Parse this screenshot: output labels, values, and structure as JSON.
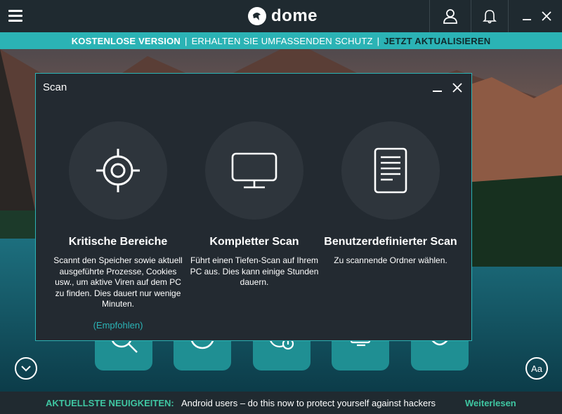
{
  "app": {
    "logo_text": "dome",
    "icons": {
      "menu": "hamburger-icon",
      "user": "user-icon",
      "notifications": "bell-icon",
      "minimize": "minimize-icon",
      "close": "close-icon"
    }
  },
  "promo": {
    "free_version": "KOSTENLOSE VERSION",
    "full_protection": "ERHALTEN SIE UMFASSENDEN SCHUTZ",
    "upgrade": "JETZT AKTUALISIEREN",
    "separator": "|"
  },
  "dialog": {
    "title": "Scan",
    "options": [
      {
        "title": "Kritische Bereiche",
        "description": "Scannt den Speicher sowie aktuell ausgeführte Prozesse, Cookies usw., um aktive Viren auf dem PC zu finden. Dies dauert nur wenige Minuten.",
        "recommended": "(Empfohlen)",
        "icon": "crosshair-icon"
      },
      {
        "title": "Kompletter Scan",
        "description": "Führt einen Tiefen-Scan auf Ihrem PC aus. Dies kann einige Stunden dauern.",
        "icon": "monitor-icon"
      },
      {
        "title": "Benutzerdefinierter Scan",
        "description": "Zu scannende Ordner wählen.",
        "icon": "document-icon"
      }
    ]
  },
  "controls": {
    "font_size_label": "Aa"
  },
  "news": {
    "label": "AKTUELLSTE NEUIGKEITEN:",
    "headline": "Android users – do this now to protect yourself against hackers",
    "read_more": "Weiterlesen"
  },
  "colors": {
    "accent": "#2bb3b5",
    "news_accent": "#3fc6a2",
    "dialog_bg": "#232a31",
    "titlebar_bg": "#1f2a30"
  }
}
